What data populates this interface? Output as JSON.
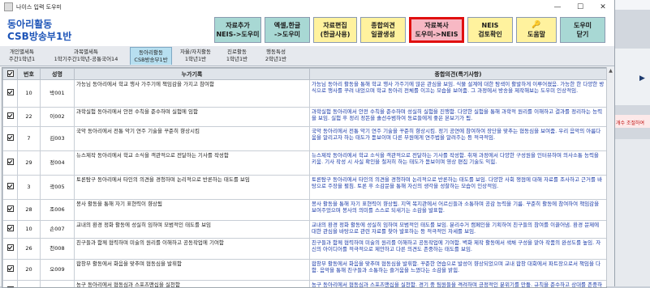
{
  "window": {
    "title": "나이스 입력 도우미",
    "controls": [
      "—",
      "☐",
      "✕"
    ]
  },
  "app": {
    "title_line1": "동아리활동",
    "title_line2": "CSB방송부1반"
  },
  "toolbar": [
    {
      "line1": "자료추가",
      "line2": "NEIS->도우미",
      "color": "teal"
    },
    {
      "line1": "엑셀,한글",
      "line2": "->도우미",
      "color": "teal"
    },
    {
      "line1": "자료편집",
      "line2": "(한글사용)",
      "color": "yellow"
    },
    {
      "line1": "종합의견",
      "line2": "일괄생성",
      "color": "yellow"
    },
    {
      "line1": "자료복사",
      "line2": "도우미->NEIS",
      "color": "pink",
      "selected": true
    },
    {
      "line1": "NEIS",
      "line2": "검토확인",
      "color": "yellow"
    },
    {
      "line1": "",
      "line2": "도움말",
      "color": "yellow"
    },
    {
      "line1": "도우미",
      "line2": "닫기",
      "color": "teal"
    }
  ],
  "tabs": [
    {
      "line1": "개인별세특",
      "line2": "주간1학년1"
    },
    {
      "line1": "과목별세특",
      "line2": "1학기주간1학년-공통국어14"
    },
    {
      "line1": "동아리활동",
      "line2": "CSB방송부1반",
      "active": true
    },
    {
      "line1": "자율/자치활동",
      "line2": "1학년1반"
    },
    {
      "line1": "진로활동",
      "line2": "1학년1반"
    },
    {
      "line1": "행동특성",
      "line2": "2학년1반"
    }
  ],
  "table": {
    "headers": [
      "☑",
      "번호",
      "성명",
      "누가기록",
      "종합의견(특기사항)"
    ],
    "rows": [
      {
        "no": "10",
        "name": "박001",
        "record": "가능님 동아리에서 학교 행사 가주기에 책임감을 가지고 참여함",
        "opinion": "가능님 동아리 활동을 통해 학교 행사 가주기에 많은 관심을 보임. 식물 설계에 대한 탐색이 활발하게 이루어졌음. 가능한 한 다양한 방식으로 행사를 꾸려 내었으며 학교 동아리 전체를 이끄는 모습을 보여줌. 그 과정에서 방송을 제작해보는 도우미 인상적임."
      },
      {
        "no": "22",
        "name": "이002",
        "record": "과학실험 동아리에서 안전 수칙을 준수하며 실험에 임함",
        "opinion": "과학실험 동아리에서 안전 수칙을 준수하며 성실히 실험을 진행함. 다양한 실험을 통해 과학적 원리를 이해하고 결과를 정리하는 능력을 보임. 실험 후 정리 정돈을 솔선수범하여 동료들에게 좋은 본보기가 됨."
      },
      {
        "no": "7",
        "name": "김003",
        "record": "국악 동아리에서 전통 악기 연주 기술을 꾸준히 향상시킴",
        "opinion": "국악 동아리에서 전통 악기 연주 기술을 꾸준히 향상시킴. 정기 공연에 참여하여 장단을 맞추는 협동심을 보여줌. 우리 음악의 아름다움을 알리고자 하는 태도가 돋보이며 다른 부원에게 연주법을 알려주는 등 적극적임."
      },
      {
        "no": "29",
        "name": "정004",
        "record": "뉴스제작 동아리에서 학교 소식을 객관적으로 전달하는 기사를 작성함",
        "opinion": "뉴스제작 동아리에서 학교 소식을 객관적으로 전달하는 기사를 작성함. 취재 과정에서 다양한 구성원을 인터뷰하며 의사소통 능력을 키움. 기사 작성 시 사실 확인을 철저히 하는 태도가 돋보이며 영상 편집 기술도 익힘."
      },
      {
        "no": "3",
        "name": "곽005",
        "record": "토론탐구 동아리에서 타인의 의견을 경청하며 논리적으로 반론하는 태도를 보임",
        "opinion": "토론탐구 동아리에서 타인의 의견을 경청하며 논리적으로 반론하는 태도를 보임. 다양한 사회 쟁점에 대해 자료를 조사하고 근거를 바탕으로 주장을 펼침. 토론 후 소감문을 통해 자신의 생각을 성찰하는 모습이 인상적임."
      },
      {
        "no": "28",
        "name": "조006",
        "record": "봉사 활동을 통해 자기 표현력이 향상됨",
        "opinion": "봉사 활동을 통해 자기 표현력이 향상됨. 지역 복지관에서 어르신들과 소통하며 공감 능력을 기름. 꾸준히 활동에 참여하여 책임감을 보여주었으며 봉사의 의미를 스스로 되새기는 소감을 발표함."
      },
      {
        "no": "10",
        "name": "손007",
        "record": "교내의 환경 정화 활동에 성실히 임하며 모범적인 태도를 보임",
        "opinion": "교내의 환경 정화 활동에 성실히 임하며 모범적인 태도를 보임. 분리수거 캠페인을 기획하여 친구들의 참여를 이끌어냄. 환경 문제에 대한 관심을 바탕으로 관련 자료를 찾아 발표하는 등 적극적인 자세를 보임."
      },
      {
        "no": "26",
        "name": "천008",
        "record": "친구들과 함께 협력하며 미술의 원리를 이해하고 공동작업에 기여함",
        "opinion": "친구들과 함께 협력하며 미술의 원리를 이해하고 공동작업에 기여함. 벽화 제작 활동에서 색채 구성을 맡아 작품의 완성도를 높임. 자신의 아이디어를 적극적으로 제안하고 다른 의견도 존중하는 태도를 보임."
      },
      {
        "no": "20",
        "name": "오009",
        "record": "합창부 활동에서 화음을 맞추며 협동심을 발휘함",
        "opinion": "합창부 활동에서 화음을 맞추며 협동심을 발휘함. 꾸준한 연습으로 발성이 향상되었으며 교내 합창 대회에서 파트장으로서 책임을 다함. 음악을 통해 친구들과 소통하는 즐거움을 느꼈다는 소감을 밝힘."
      },
      {
        "no": "32",
        "name": "홍010",
        "record": "농구 동아리에서 협동심과 스포츠맨십을 실천함",
        "opinion": "농구 동아리에서 협동심과 스포츠맨십을 실천함. 경기 중 팀원들을 격려하며 긍정적인 분위기를 만듦. 규칙을 준수하고 상대를 존중하는 태도가 돋보이며 체력 향상을 위해 꾸준히 노력하는 모습을 보임."
      }
    ]
  },
  "right_panel": {
    "notice": "개수 조절하여"
  }
}
